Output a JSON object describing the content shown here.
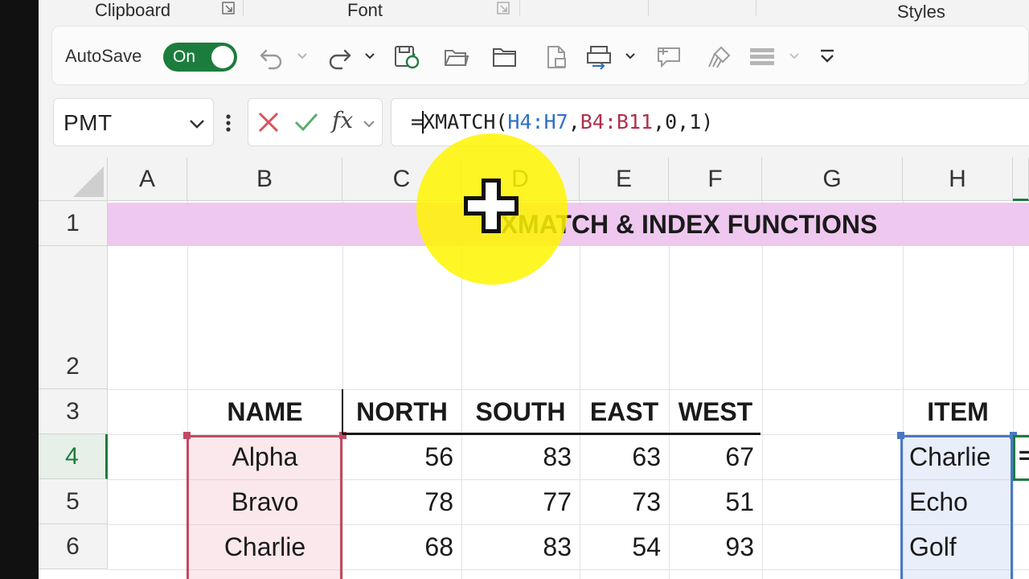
{
  "ribbon": {
    "groups": [
      "Clipboard",
      "Font",
      "Styles"
    ]
  },
  "quick_access": {
    "autosave_label": "AutoSave",
    "autosave_state": "On",
    "icons": [
      "undo-icon",
      "redo-icon",
      "save-refresh-icon",
      "open-folder-icon",
      "folder-icon",
      "document-icon",
      "print-preview-icon",
      "comment-icon",
      "format-painter-icon",
      "borders-icon",
      "customize-toolbar-icon"
    ]
  },
  "formula_bar": {
    "name_box": "PMT",
    "fx_label": "fx",
    "formula_prefix": "=",
    "formula_func": "XMATCH(",
    "formula_arg1": "H4:H7",
    "formula_comma1": ",",
    "formula_arg2": "B4:B11",
    "formula_rest": ",0,1)"
  },
  "columns": [
    "A",
    "B",
    "C",
    "D",
    "E",
    "F",
    "G",
    "H"
  ],
  "rows": [
    "1",
    "2",
    "3",
    "4",
    "5",
    "6"
  ],
  "title": "XMATCH & INDEX FUNCTIONS",
  "table": {
    "headers": [
      "NAME",
      "NORTH",
      "SOUTH",
      "EAST",
      "WEST"
    ],
    "rows": [
      [
        "Alpha",
        "56",
        "83",
        "63",
        "67"
      ],
      [
        "Bravo",
        "78",
        "77",
        "73",
        "51"
      ],
      [
        "Charlie",
        "68",
        "83",
        "54",
        "93"
      ]
    ]
  },
  "lookup": {
    "header": "ITEM",
    "items": [
      "Charlie",
      "Echo",
      "Golf"
    ]
  },
  "active_cell_text": "=",
  "colors": {
    "accent_green": "#1c7c3d",
    "title_band": "#efc8ef",
    "ref_blue": "#2f6fc6",
    "ref_red": "#b0304a",
    "highlight": "#fff500"
  }
}
